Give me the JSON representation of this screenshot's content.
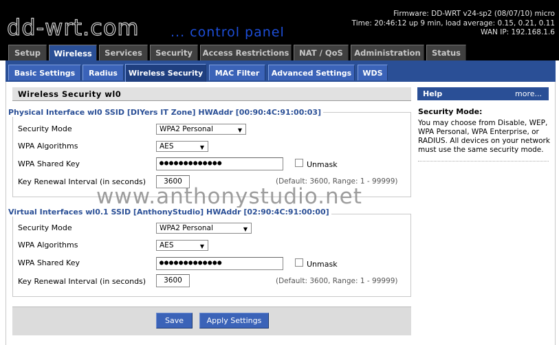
{
  "header": {
    "logo_text": "dd-wrt.com",
    "tagline": "... control panel",
    "firmware": "Firmware: DD-WRT v24-sp2 (08/07/10) micro",
    "time": "Time: 20:46:12 up 9 min, load average: 0.15, 0.21, 0.11",
    "wan_ip": "WAN IP: 192.168.1.6"
  },
  "top_tabs": [
    "Setup",
    "Wireless",
    "Services",
    "Security",
    "Access Restrictions",
    "NAT / QoS",
    "Administration",
    "Status"
  ],
  "sub_tabs": [
    "Basic Settings",
    "Radius",
    "Wireless Security",
    "MAC Filter",
    "Advanced Settings",
    "WDS"
  ],
  "panel_title": "Wireless Security wl0",
  "physical": {
    "legend": "Physical Interface wl0 SSID [DIYers IT Zone] HWAddr [00:90:4C:91:00:03]",
    "security_mode_label": "Security Mode",
    "security_mode_value": "WPA2 Personal",
    "wpa_alg_label": "WPA Algorithms",
    "wpa_alg_value": "AES",
    "shared_key_label": "WPA Shared Key",
    "shared_key_value": "●●●●●●●●●●●●●",
    "unmask_label": "Unmask",
    "renewal_label": "Key Renewal Interval (in seconds)",
    "renewal_value": "3600",
    "renewal_hint": "(Default: 3600, Range: 1 - 99999)"
  },
  "virtual": {
    "legend": "Virtual Interfaces wl0.1 SSID [AnthonyStudio] HWAddr [02:90:4C:91:00:00]",
    "security_mode_label": "Security Mode",
    "security_mode_value": "WPA2 Personal",
    "wpa_alg_label": "WPA Algorithms",
    "wpa_alg_value": "AES",
    "shared_key_label": "WPA Shared Key",
    "shared_key_value": "●●●●●●●●●●●●●",
    "unmask_label": "Unmask",
    "renewal_label": "Key Renewal Interval (in seconds)",
    "renewal_value": "3600",
    "renewal_hint": "(Default: 3600, Range: 1 - 99999)"
  },
  "watermark": "www.anthonystudio.net",
  "buttons": {
    "save": "Save",
    "apply": "Apply Settings"
  },
  "help": {
    "title": "Help",
    "more": "more...",
    "heading": "Security Mode:",
    "body": "You may choose from Disable, WEP, WPA Personal, WPA Enterprise, or RADIUS. All devices on your network must use the same security mode."
  },
  "colors": {
    "accent": "#2a4f96",
    "tab_blue": "#3b63b8",
    "header_bg": "#000000"
  }
}
